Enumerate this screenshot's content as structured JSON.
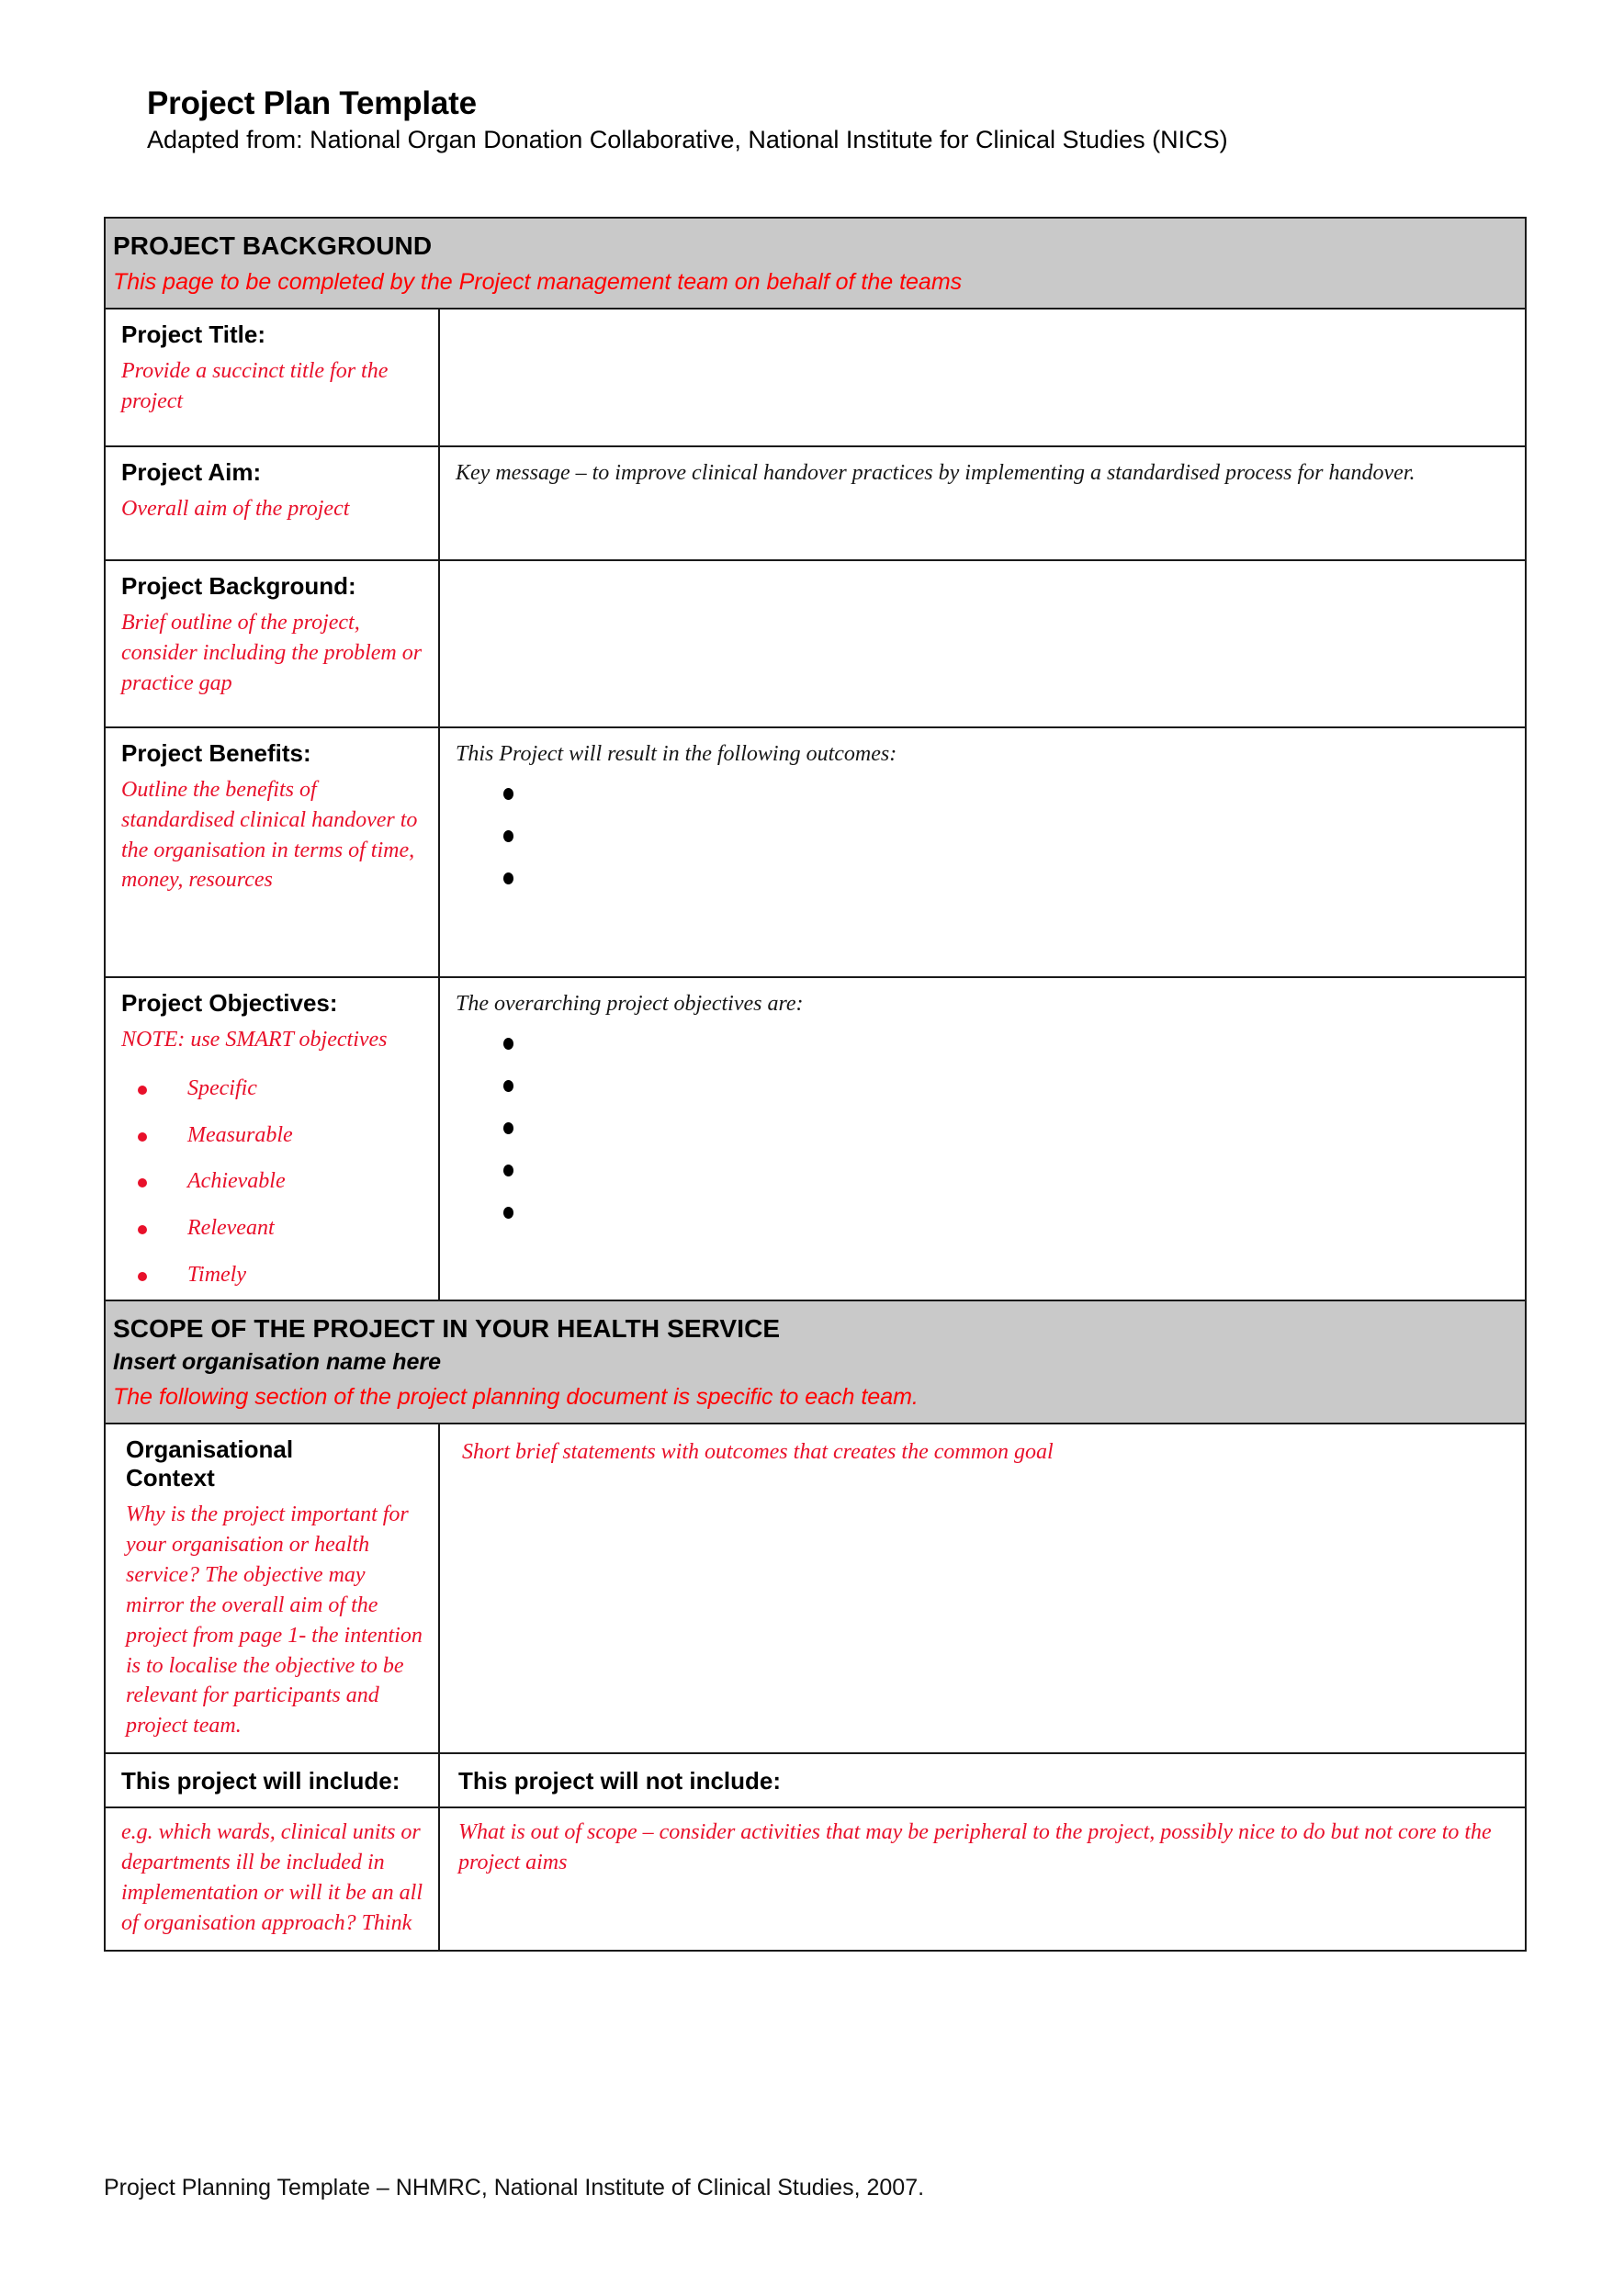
{
  "document": {
    "title": "Project Plan Template",
    "subtitle": "Adapted from: National Organ Donation Collaborative, National Institute for Clinical Studies (NICS)",
    "footer": "Project Planning Template – NHMRC, National Institute of Clinical Studies, 2007."
  },
  "colors": {
    "band_background": "#c9c9c9",
    "instruction_red": "#e8102a",
    "note_red": "#ff0000",
    "text_black": "#000000",
    "border": "#1a1a1a"
  },
  "sections": {
    "background": {
      "band_title": "PROJECT BACKGROUND",
      "band_note": "This page to be completed by the Project management team on behalf of the teams",
      "rows": {
        "project_title": {
          "label": "Project Title:",
          "hint": "Provide a succinct title for the project",
          "value": ""
        },
        "project_aim": {
          "label": "Project Aim:",
          "hint": "Overall aim of the project",
          "value": "Key message – to improve clinical handover practices by implementing a standardised process for handover."
        },
        "project_background": {
          "label": "Project Background:",
          "hint": "Brief outline of the project, consider including the problem or practice gap",
          "value": ""
        },
        "project_benefits": {
          "label": "Project Benefits:",
          "hint": "Outline the benefits of standardised clinical handover to the organisation in terms of time, money, resources",
          "value_lead": "This Project will result in the following outcomes:",
          "bullets": [
            "",
            "",
            ""
          ]
        },
        "project_objectives": {
          "label": "Project Objectives:",
          "hint": "NOTE: use SMART objectives",
          "smart_bullets": [
            "Specific",
            "Measurable",
            "Achievable",
            "Releveant",
            "Timely"
          ],
          "value_lead": "The overarching project objectives are:",
          "bullets": [
            "",
            "",
            "",
            "",
            ""
          ]
        }
      }
    },
    "scope": {
      "band_title": "SCOPE OF THE PROJECT IN YOUR HEALTH SERVICE",
      "band_subtitle": "Insert organisation name here",
      "band_note": "The following section of the project planning document is specific to each team.",
      "rows": {
        "organisational_context": {
          "label": "Organisational Context",
          "hint": "Why is the project important for your organisation or health service? The objective may mirror the overall aim of the project from page 1- the intention is to localise the objective to be relevant for participants and project team.",
          "value": "Short brief statements with outcomes that creates the common goal"
        },
        "include": {
          "header": "This project will include:",
          "hint": "e.g. which wards, clinical units or departments ill be included in implementation or will it be an all of organisation approach? Think"
        },
        "not_include": {
          "header": "This project will not include:",
          "hint": "What is out of scope – consider activities that may be peripheral to the project, possibly nice to do but not core to the project aims"
        }
      }
    }
  }
}
